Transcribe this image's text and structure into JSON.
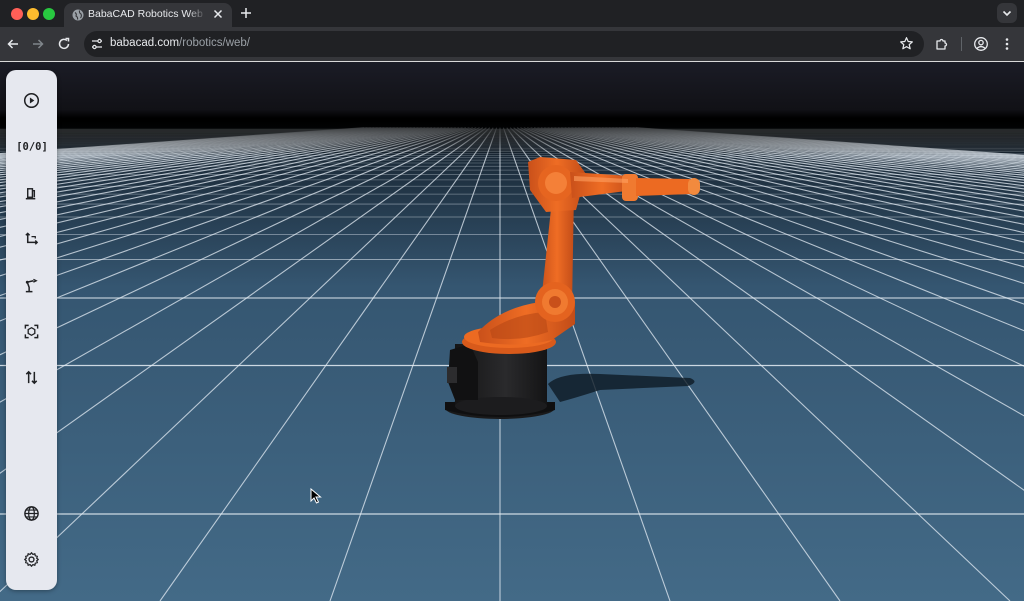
{
  "browser": {
    "tab_title": "BabaCAD Robotics Web - Free",
    "url_host": "babacad.com",
    "url_path": "/robotics/web/"
  },
  "toolpanel": {
    "tools": [
      {
        "name": "play",
        "icon": "play-circle-icon"
      },
      {
        "name": "counter",
        "label": "[0/0]"
      },
      {
        "name": "robot-base",
        "icon": "robot-base-icon"
      },
      {
        "name": "axis-transform",
        "icon": "axis-transform-icon"
      },
      {
        "name": "robot-arm",
        "icon": "robot-arm-icon"
      },
      {
        "name": "focus-object",
        "icon": "focus-target-icon"
      },
      {
        "name": "swap-direction",
        "icon": "swap-vertical-icon"
      },
      {
        "name": "language",
        "icon": "globe-icon"
      },
      {
        "name": "settings",
        "icon": "gear-icon"
      }
    ]
  },
  "colors": {
    "floor": "#40647f",
    "grid_line": "#e6eef5",
    "sky": "#1b1c26",
    "robot_orange": "#e8641d",
    "robot_base": "#1f1f21",
    "panel_bg": "#e6e8ef"
  }
}
